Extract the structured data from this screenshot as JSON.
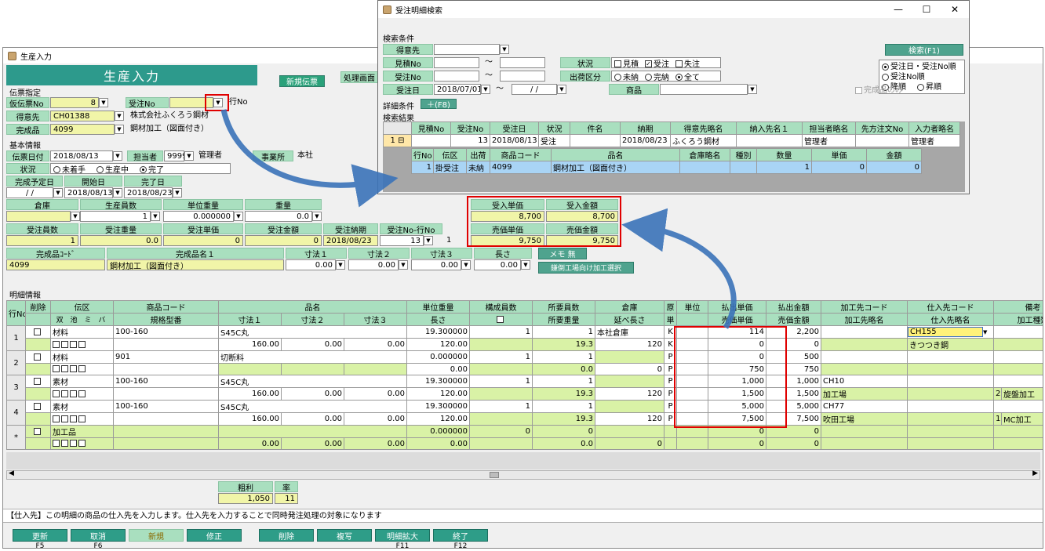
{
  "main": {
    "title": "生産入力",
    "banner": "生産入力",
    "new_badge": "新規伝票",
    "process_tab": "処理画面",
    "voucher_section": "伝票指定",
    "voucher_no_label": "仮伝票No",
    "voucher_no_value": "8",
    "order_no_label": "受注No",
    "row_no_label": "行No",
    "customer_label": "得意先",
    "customer_code": "CH01388",
    "customer_name": "株式会社ふくろう鋼材",
    "product_label": "完成品",
    "product_code": "4099",
    "product_name": "鋼材加工（図面付き）",
    "basic_section": "基本情報",
    "date_label": "伝票日付",
    "date_value": "2018/08/13",
    "staff_label": "担当者",
    "staff_code": "9999",
    "staff_name": "管理者",
    "office_label": "事業所",
    "office_value": "本社",
    "status_label": "状況",
    "status_options": [
      "未着手",
      "生産中",
      "完了"
    ],
    "plan_label": "完成予定日",
    "plan_value": "/ /",
    "start_label": "開始日",
    "start_value": "2018/08/13",
    "done_label": "完了日",
    "done_value": "2018/08/23",
    "warehouse_label": "倉庫",
    "prodcount_label": "生産員数",
    "prodcount_value": "1",
    "unitweight_label": "単位重量",
    "unitweight_value": "0.000000",
    "weight_label": "重量",
    "weight_value": "0.0",
    "ordcount_label": "受注員数",
    "ordcount_value": "1",
    "ordweight_label": "受注重量",
    "ordweight_value": "0.0",
    "ordprice_label": "受注単価",
    "ordprice_value": "0",
    "ordamount_label": "受注金額",
    "ordamount_value": "0",
    "delivery_label": "受注納期",
    "delivery_value": "2018/08/23",
    "ordrow_label": "受注No-行No",
    "ordrow_value": "13",
    "ordrow_sub": "1",
    "pcode_label": "完成品ｺｰﾄﾞ",
    "pcode_value": "4099",
    "pname_label": "完成品名１",
    "pname_value": "鋼材加工（図面付き）",
    "dim1_label": "寸法１",
    "dim2_label": "寸法２",
    "dim3_label": "寸法３",
    "len_label": "長さ",
    "dim_value": "0.00",
    "memo_button": "メモ 無",
    "outsource_button": "鎌倒工場向け加工選択",
    "price_box": {
      "in_price_label": "受入単価",
      "in_amount_label": "受入金額",
      "in_price": "8,700",
      "in_amount": "8,700",
      "sale_price_label": "売価単価",
      "sale_amount_label": "売価金額",
      "sale_price": "9,750",
      "sale_amount": "9,750"
    },
    "detail_section": "明細情報",
    "detail_headers": {
      "rowno": "行No",
      "del": "削除",
      "kind": "伝区",
      "kind_sub": [
        "双",
        "池",
        "ミ",
        "バ"
      ],
      "pcode": "商品コード",
      "spec": "規格型番",
      "pname": "品名",
      "d1": "寸法１",
      "d2": "寸法２",
      "d3": "寸法３",
      "uw": "単位重量",
      "len": "長さ",
      "comp": "構成員数",
      "req": "所要員数",
      "reqw": "所要重量",
      "wh": "倉庫",
      "whlen": "延べ長さ",
      "src": "原",
      "unitc": "単",
      "unit": "単位",
      "outp": "払出単価",
      "outa": "払出金額",
      "sellp": "売価単価",
      "sella": "売価金額",
      "proc": "加工先コード",
      "procn": "加工先略名",
      "sup": "仕入先コード",
      "supn": "仕入先略名",
      "note": "備考",
      "ptype": "加工種類"
    },
    "detail_rows": [
      {
        "no": "1",
        "kind": "材料",
        "pcode": "100-160",
        "pname": "S45C丸",
        "d1": "160.00",
        "d2": "0.00",
        "d3": "0.00",
        "uw": "19.300000",
        "len": "120.00",
        "comp": "1",
        "req": "1",
        "reqw": "19.3",
        "wh": "本社倉庫",
        "whlen": "120",
        "src": "K",
        "outp": "114",
        "outa": "2,200",
        "sellp": "0",
        "sella": "0",
        "proc": "",
        "procn": "",
        "sup": "CH155",
        "supn": "きつつき鋼",
        "ptc": "",
        "ptype": ""
      },
      {
        "no": "2",
        "kind": "材料",
        "pcode": "901",
        "pname": "切断料",
        "d1": "",
        "d2": "",
        "d3": "",
        "uw": "0.000000",
        "len": "0.00",
        "comp": "1",
        "req": "1",
        "reqw": "0.0",
        "wh": "",
        "whlen": "0",
        "src": "P",
        "outp": "0",
        "outa": "500",
        "sellp": "750",
        "sella": "750",
        "proc": "",
        "procn": "",
        "sup": "",
        "supn": "",
        "ptc": "",
        "ptype": ""
      },
      {
        "no": "3",
        "kind": "素材",
        "pcode": "100-160",
        "pname": "S45C丸",
        "d1": "160.00",
        "d2": "0.00",
        "d3": "0.00",
        "uw": "19.300000",
        "len": "120.00",
        "comp": "1",
        "req": "1",
        "reqw": "19.3",
        "wh": "",
        "whlen": "120",
        "src": "P",
        "outp": "1,000",
        "outa": "1,000",
        "sellp": "1,500",
        "sella": "1,500",
        "proc": "CH10",
        "procn": "加工場",
        "sup": "",
        "supn": "",
        "ptc": "2",
        "ptype": "旋盤加工"
      },
      {
        "no": "4",
        "kind": "素材",
        "pcode": "100-160",
        "pname": "S45C丸",
        "d1": "160.00",
        "d2": "0.00",
        "d3": "0.00",
        "uw": "19.300000",
        "len": "120.00",
        "comp": "1",
        "req": "1",
        "reqw": "19.3",
        "wh": "",
        "whlen": "120",
        "src": "P",
        "outp": "5,000",
        "outa": "5,000",
        "sellp": "7,500",
        "sella": "7,500",
        "proc": "CH77",
        "procn": "吹田工場",
        "sup": "",
        "supn": "",
        "ptc": "1",
        "ptype": "MC加工"
      }
    ],
    "new_row": {
      "marker": "*",
      "kind": "加工品",
      "uw": "0.000000",
      "comp": "0",
      "req": "0",
      "d1": "0.00",
      "d2": "0.00",
      "d3": "0.00",
      "len": "0.00",
      "reqw": "0.0",
      "whlen": "0",
      "outp": "0",
      "outa": "0",
      "sellp": "0",
      "sella": "0"
    },
    "profit_label": "粗利",
    "rate_label": "率",
    "profit_value": "1,050",
    "rate_value": "11",
    "status_message": "【仕入先】この明細の商品の仕入先を入力します。仕入先を入力することで同時発注処理の対象になります",
    "fbuttons": [
      {
        "label": "更新",
        "key": "F5"
      },
      {
        "label": "取消",
        "key": "F6"
      },
      {
        "label": "新規",
        "key": ""
      },
      {
        "label": "修正",
        "key": ""
      },
      {
        "label": "削除",
        "key": ""
      },
      {
        "label": "複写",
        "key": ""
      },
      {
        "label": "明細拡大",
        "key": "F11"
      },
      {
        "label": "終了",
        "key": "F12"
      }
    ]
  },
  "dialog": {
    "title": "受注明細検索",
    "cond_section": "検索条件",
    "customer_label": "得意先",
    "quote_label": "見積No",
    "order_label": "受注No",
    "date_label": "受注日",
    "date_from": "2018/07/01",
    "date_to": "/ /",
    "tilde": "～",
    "status_label": "状況",
    "status_opts": [
      "見積",
      "受注",
      "失注"
    ],
    "ship_label": "出荷区分",
    "ship_opts": [
      "未納",
      "完納",
      "全て"
    ],
    "product_label": "商品",
    "search_button": "検索(F1)",
    "sort_opts": [
      "受注日・受注No順",
      "受注No順"
    ],
    "sort_desc": "降順",
    "sort_asc": "昇順",
    "done_only": "完成品のみ",
    "detail_cond": "詳細条件",
    "detail_cond_btn": "＋(F8)",
    "result_section": "検索結果",
    "result_headers": [
      "見積No",
      "受注No",
      "受注日",
      "状況",
      "件名",
      "納期",
      "得意先略名",
      "納入先名１",
      "担当者略名",
      "先方注文No",
      "入力者略名"
    ],
    "result_row": {
      "idx": "1",
      "quote": "",
      "order": "13",
      "date": "2018/08/13",
      "status": "受注",
      "subject": "",
      "due": "2018/08/23",
      "cust": "ふくろう鋼材",
      "dest": "",
      "staff": "管理者",
      "po": "",
      "inputter": "管理者"
    },
    "sub_headers": [
      "行No",
      "伝区",
      "出荷",
      "商品コード",
      "品名",
      "倉庫略名",
      "種別",
      "数量",
      "単価",
      "金額"
    ],
    "sub_row": {
      "no": "1",
      "kind": "掛受注",
      "ship": "未納",
      "code": "4099",
      "name": "鋼材加工（図面付き）",
      "wh": "",
      "type": "",
      "qty": "1",
      "price": "0",
      "amount": "0"
    }
  }
}
